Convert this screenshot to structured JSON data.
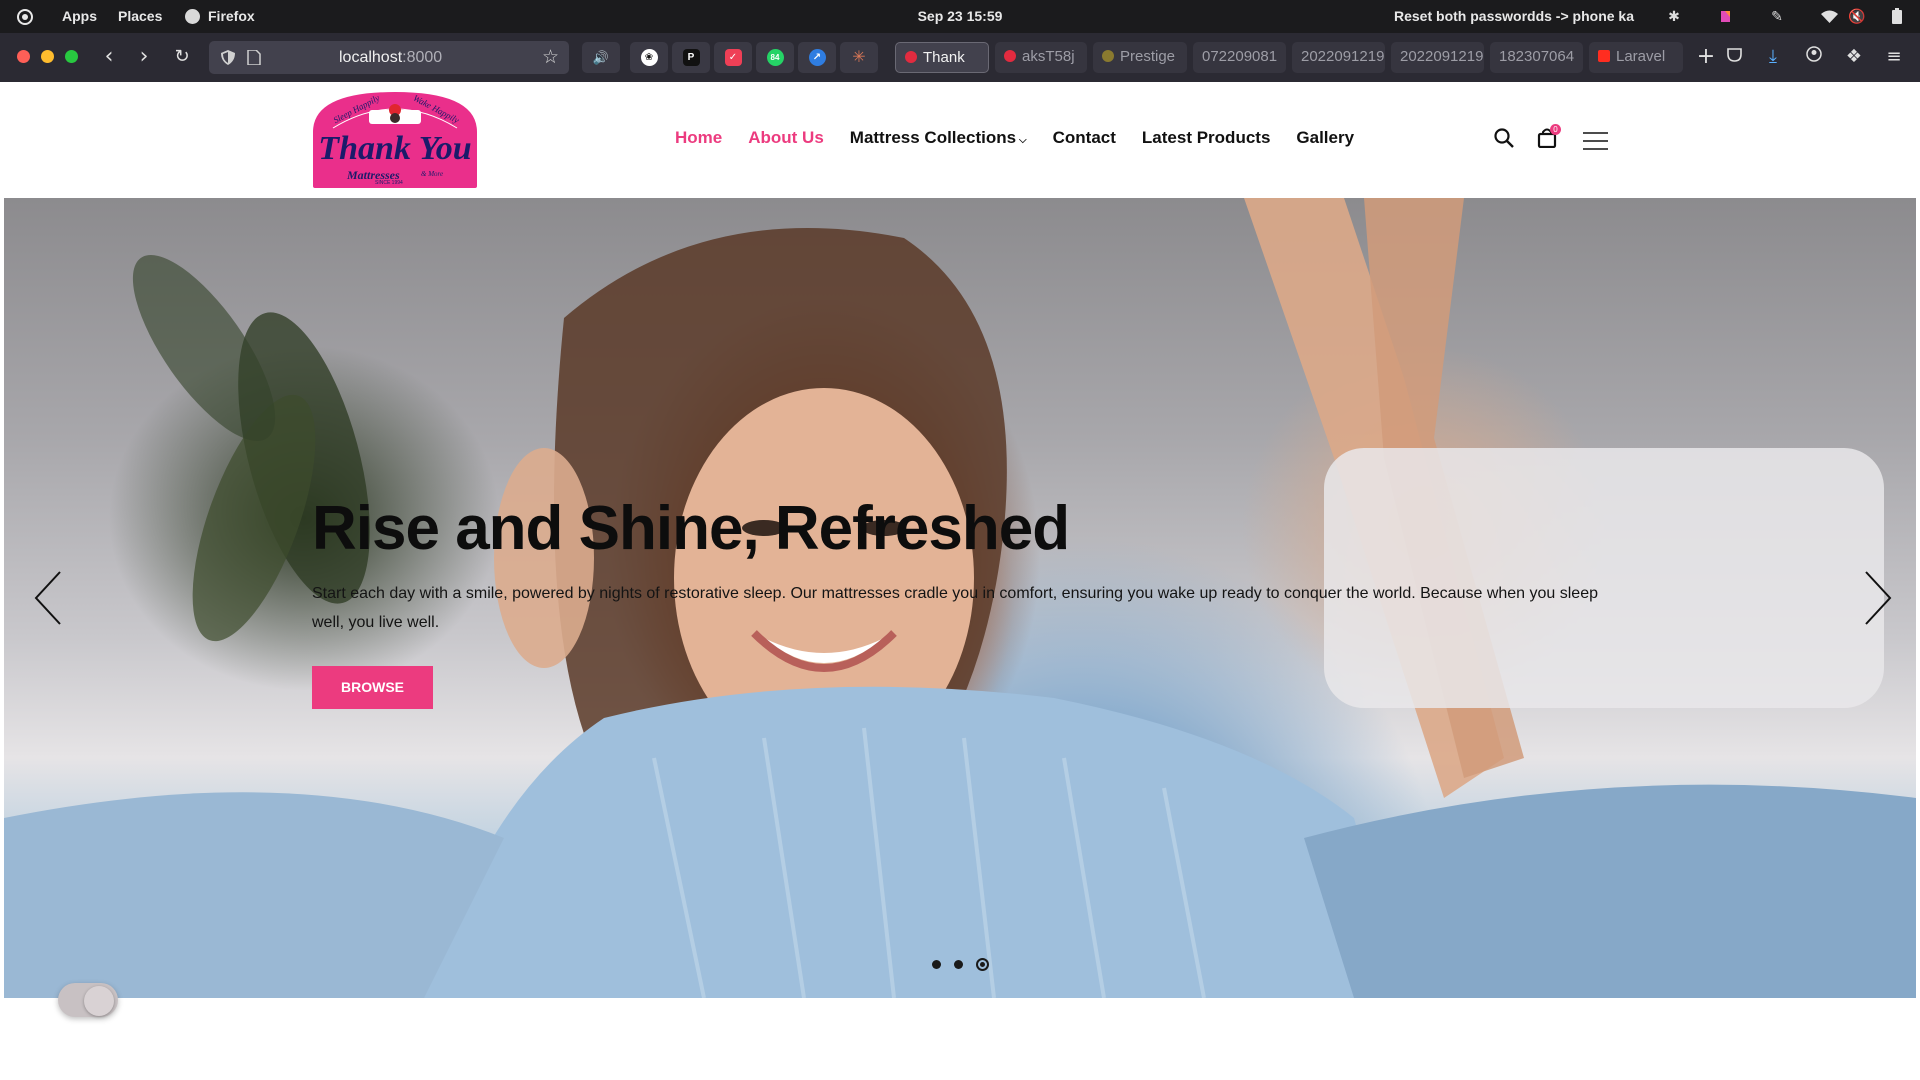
{
  "topbar": {
    "activities_icon": "activities-icon",
    "apps": "Apps",
    "places": "Places",
    "firefox": "Firefox",
    "clock": "Sep 23  15:59",
    "notification": "Reset both passwordds -> phone ka",
    "tray_icons": [
      "bluetooth-icon",
      "app-indicator-icon",
      "pen-icon",
      "wifi-icon",
      "mute-icon",
      "battery-icon"
    ]
  },
  "browser": {
    "url_host": "localhost",
    "url_port": ":8000",
    "pinned_icons": [
      "audio-icon",
      "openai-icon",
      "producthunt-icon",
      "pocket-icon",
      "whatsapp-icon",
      "safari-icon",
      "claude-icon"
    ],
    "pinned_badge": "84",
    "tabs": [
      "Thank",
      "aksT58j",
      "Prestige",
      "072209081",
      "2022091219",
      "2022091219",
      "182307064",
      "Laravel"
    ],
    "active_tab": 0
  },
  "site": {
    "logo": {
      "arc_left": "Sleep Happily",
      "arc_right": "Wake Happily",
      "brand": "Thank You",
      "sub": "Mattresses",
      "sub_more": "& More",
      "since": "SINCE 1994"
    },
    "nav": [
      {
        "label": "Home",
        "active": true
      },
      {
        "label": "About Us",
        "active": true
      },
      {
        "label": "Mattress Collections",
        "dropdown": true
      },
      {
        "label": "Contact"
      },
      {
        "label": "Latest Products"
      },
      {
        "label": "Gallery"
      }
    ],
    "cart_count": "0",
    "icons": [
      "search-icon",
      "cart-icon",
      "menu-icon"
    ]
  },
  "hero": {
    "title": "Rise and Shine, Refreshed",
    "text": "Start each day with a smile, powered by nights of restorative sleep. Our mattresses cradle you in comfort, ensuring you wake up ready to conquer the world. Because when you sleep well, you live well.",
    "button": "BROWSE",
    "slide_count": 3,
    "active_slide": 3
  },
  "colors": {
    "accent": "#ec3b7f",
    "topbar_bg": "#1b1b1d",
    "chrome_bg": "#2b2a33"
  }
}
